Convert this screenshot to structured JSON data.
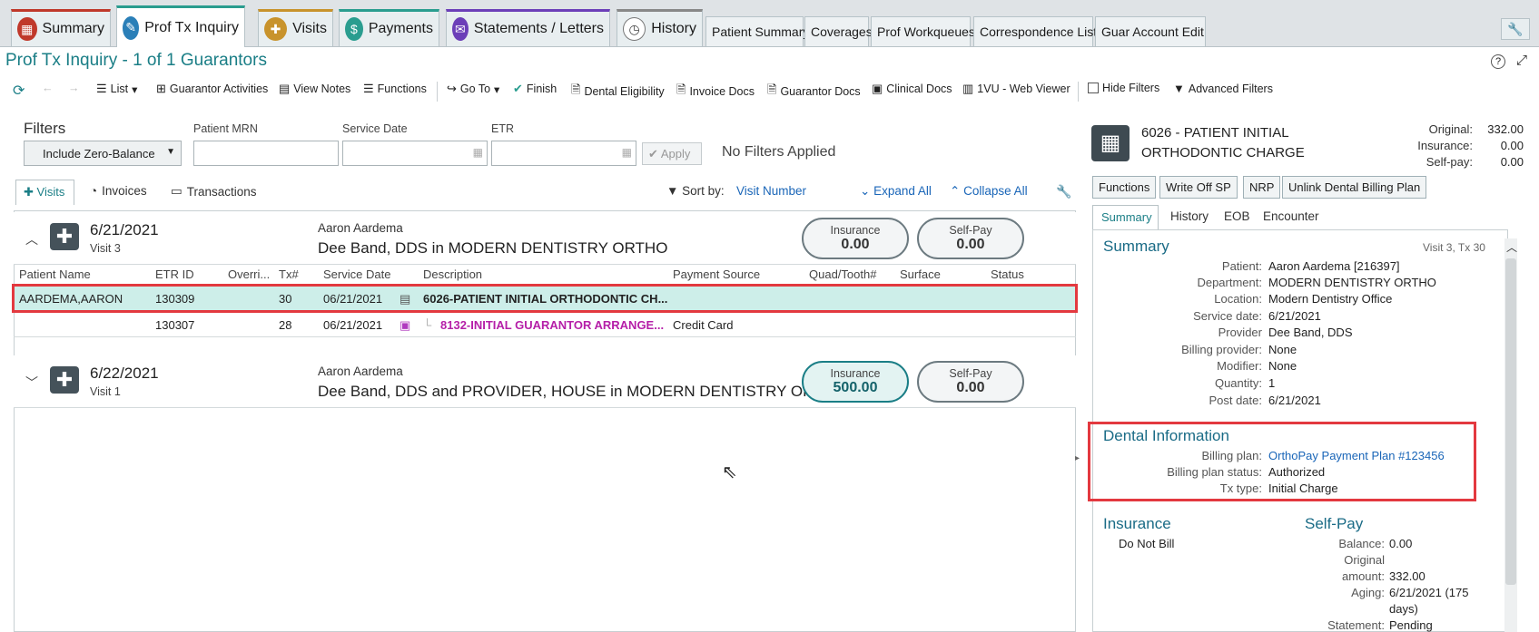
{
  "tabs": {
    "summary": "Summary",
    "prof_tx_inquiry": "Prof Tx Inquiry",
    "visits": "Visits",
    "payments": "Payments",
    "statements": "Statements / Letters",
    "history": "History",
    "patient_summary": "Patient Summary",
    "coverages": "Coverages",
    "prof_workqueues": "Prof Workqueues",
    "correspondence": "Correspondence List",
    "guar_account": "Guar Account Edit"
  },
  "page": {
    "title": "Prof Tx Inquiry - 1 of 1 Guarantors"
  },
  "toolbar": {
    "list": "List",
    "guarantor_activities": "Guarantor Activities",
    "view_notes": "View Notes",
    "functions": "Functions",
    "go_to": "Go To",
    "finish": "Finish",
    "dental_eligibility": "Dental Eligibility",
    "invoice_docs": "Invoice Docs",
    "guarantor_docs": "Guarantor Docs",
    "clinical_docs": "Clinical Docs",
    "web_viewer": "1VU - Web Viewer",
    "hide_filters": "Hide Filters",
    "advanced_filters": "Advanced Filters"
  },
  "filters": {
    "heading": "Filters",
    "zero_balance": "Include Zero-Balance",
    "mrn_label": "Patient MRN",
    "service_date_label": "Service Date",
    "etr_label": "ETR",
    "apply": "Apply",
    "status": "No Filters Applied"
  },
  "subtabs": {
    "visits": "Visits",
    "invoices": "Invoices",
    "transactions": "Transactions",
    "sort_by": "Sort by:",
    "sort_value": "Visit Number",
    "expand_all": "Expand All",
    "collapse_all": "Collapse All"
  },
  "visits": [
    {
      "date": "6/21/2021",
      "visit": "Visit 3",
      "patient": "Aaron Aardema",
      "provider": "Dee Band, DDS in MODERN DENTISTRY ORTHO",
      "insurance_label": "Insurance",
      "insurance": "0.00",
      "selfpay_label": "Self-Pay",
      "selfpay": "0.00"
    },
    {
      "date": "6/22/2021",
      "visit": "Visit 1",
      "patient": "Aaron Aardema",
      "provider": "Dee Band, DDS and PROVIDER, HOUSE in MODERN DENTISTRY OR...",
      "insurance_label": "Insurance",
      "insurance": "500.00",
      "selfpay_label": "Self-Pay",
      "selfpay": "0.00"
    }
  ],
  "columns": [
    "Patient Name",
    "ETR ID",
    "Overri...",
    "Tx#",
    "Service Date",
    "Description",
    "Payment Source",
    "Quad/Tooth#",
    "Surface",
    "Status"
  ],
  "rows": [
    {
      "patient": "AARDEMA,AARON",
      "etr": "130309",
      "tx": "30",
      "date": "06/21/2021",
      "desc": "6026-PATIENT INITIAL ORTHODONTIC CH...",
      "source": ""
    },
    {
      "patient": "",
      "etr": "130307",
      "tx": "28",
      "date": "06/21/2021",
      "desc": "8132-INITIAL GUARANTOR ARRANGE...",
      "source": "Credit Card"
    }
  ],
  "detail": {
    "title": "6026 - PATIENT INITIAL ORTHODONTIC CHARGE",
    "original_label": "Original:",
    "original": "332.00",
    "insurance_label": "Insurance:",
    "insurance": "0.00",
    "selfpay_label": "Self-pay:",
    "selfpay": "0.00",
    "buttons": {
      "functions": "Functions",
      "write_off": "Write Off SP",
      "nrp": "NRP",
      "unlink": "Unlink Dental Billing Plan"
    },
    "tabs": {
      "summary": "Summary",
      "history": "History",
      "eob": "EOB",
      "encounter": "Encounter"
    },
    "summary": {
      "heading": "Summary",
      "visit_tx": "Visit 3, Tx 30",
      "patient_l": "Patient:",
      "patient": "Aaron Aardema [216397]",
      "department_l": "Department:",
      "department": "MODERN DENTISTRY ORTHO",
      "location_l": "Location:",
      "location": "Modern Dentistry Office",
      "service_date_l": "Service date:",
      "service_date": "6/21/2021",
      "provider_l": "Provider",
      "provider": "Dee Band, DDS",
      "billing_provider_l": "Billing provider:",
      "billing_provider": "None",
      "modifier_l": "Modifier:",
      "modifier": "None",
      "quantity_l": "Quantity:",
      "quantity": "1",
      "post_date_l": "Post date:",
      "post_date": "6/21/2021"
    },
    "dental": {
      "heading": "Dental Information",
      "plan_l": "Billing plan:",
      "plan": "OrthoPay Payment Plan #123456",
      "status_l": "Billing plan status:",
      "status": "Authorized",
      "tx_type_l": "Tx type:",
      "tx_type": "Initial Charge"
    },
    "insurance_section": {
      "heading": "Insurance",
      "value": "Do Not Bill"
    },
    "selfpay_section": {
      "heading": "Self-Pay",
      "balance_l": "Balance:",
      "balance": "0.00",
      "original_l1": "Original",
      "original_l2": "amount:",
      "original": "332.00",
      "aging_l": "Aging:",
      "aging1": "6/21/2021 (175",
      "aging2": "days)",
      "statement_l": "Statement:",
      "statement": "Pending"
    }
  },
  "colors": {
    "accent": "#1a7e86",
    "highlight": "#e3393f",
    "selected_row": "#cdeee9",
    "link": "#1a66b8"
  }
}
